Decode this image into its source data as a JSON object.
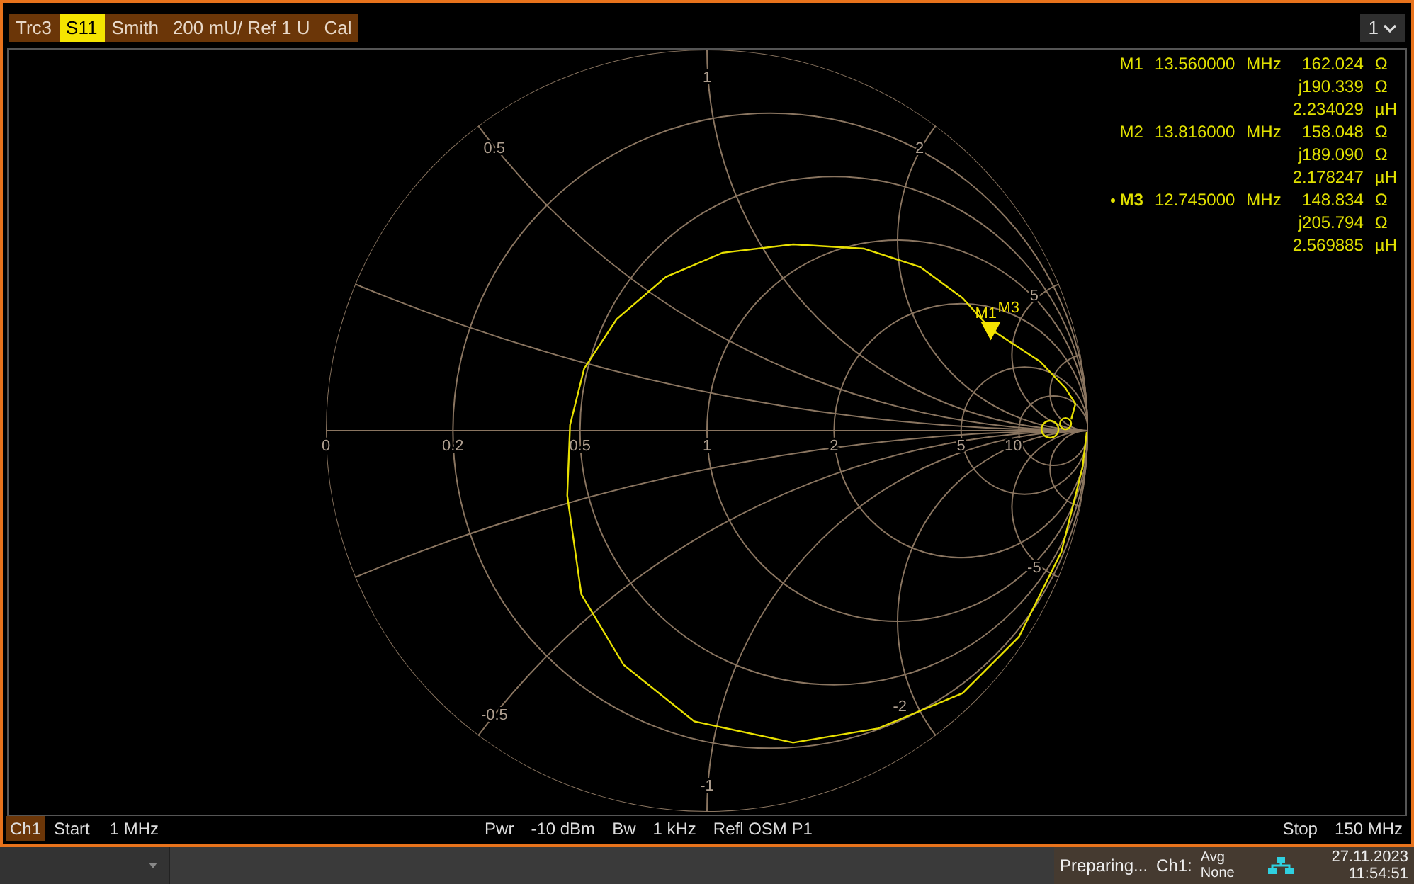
{
  "trace_header": {
    "items": [
      {
        "text": "Trc3",
        "selected": false
      },
      {
        "text": "S11",
        "selected": true
      },
      {
        "text": "Smith",
        "selected": false
      },
      {
        "text": "200 mU/ Ref 1 U",
        "selected": false
      },
      {
        "text": "Cal",
        "selected": false
      }
    ]
  },
  "diagram_selector": {
    "label": "1"
  },
  "marker_readout": [
    {
      "name": "M1",
      "active": false,
      "frequency": "13.560000",
      "frequency_unit": "MHz",
      "values": [
        {
          "value": "162.024",
          "unit": "Ω"
        },
        {
          "value": "j190.339",
          "unit": "Ω"
        },
        {
          "value": "2.234029",
          "unit": "µH"
        }
      ]
    },
    {
      "name": "M2",
      "active": false,
      "frequency": "13.816000",
      "frequency_unit": "MHz",
      "values": [
        {
          "value": "158.048",
          "unit": "Ω"
        },
        {
          "value": "j189.090",
          "unit": "Ω"
        },
        {
          "value": "2.178247",
          "unit": "µH"
        }
      ]
    },
    {
      "name": "M3",
      "active": true,
      "frequency": "12.745000",
      "frequency_unit": "MHz",
      "values": [
        {
          "value": "148.834",
          "unit": "Ω"
        },
        {
          "value": "j205.794",
          "unit": "Ω"
        },
        {
          "value": "2.569885",
          "unit": "µH"
        }
      ]
    }
  ],
  "smith_chart": {
    "resistance_labels": [
      "0",
      "0.2",
      "0.5",
      "1",
      "2",
      "5",
      "10"
    ],
    "reactance_labels": [
      "0.5",
      "1",
      "2",
      "5",
      "-5",
      "-2",
      "-1",
      "-0.5"
    ],
    "markers": [
      {
        "label": "M1"
      },
      {
        "label": "M3"
      }
    ]
  },
  "channel_bar": {
    "channel": "Ch1",
    "start_label": "Start",
    "start": "1 MHz",
    "power_label": "Pwr",
    "power": "-10 dBm",
    "bandwidth_label": "Bw",
    "bandwidth": "1 kHz",
    "calibration": "Refl OSM P1",
    "stop_label": "Stop",
    "stop": "150 MHz"
  },
  "status_bar": {
    "message": "Preparing...",
    "channel": "Ch1:",
    "averaging_label": "Avg",
    "averaging": "None",
    "date": "27.11.2023",
    "time": "11:54:51"
  }
}
